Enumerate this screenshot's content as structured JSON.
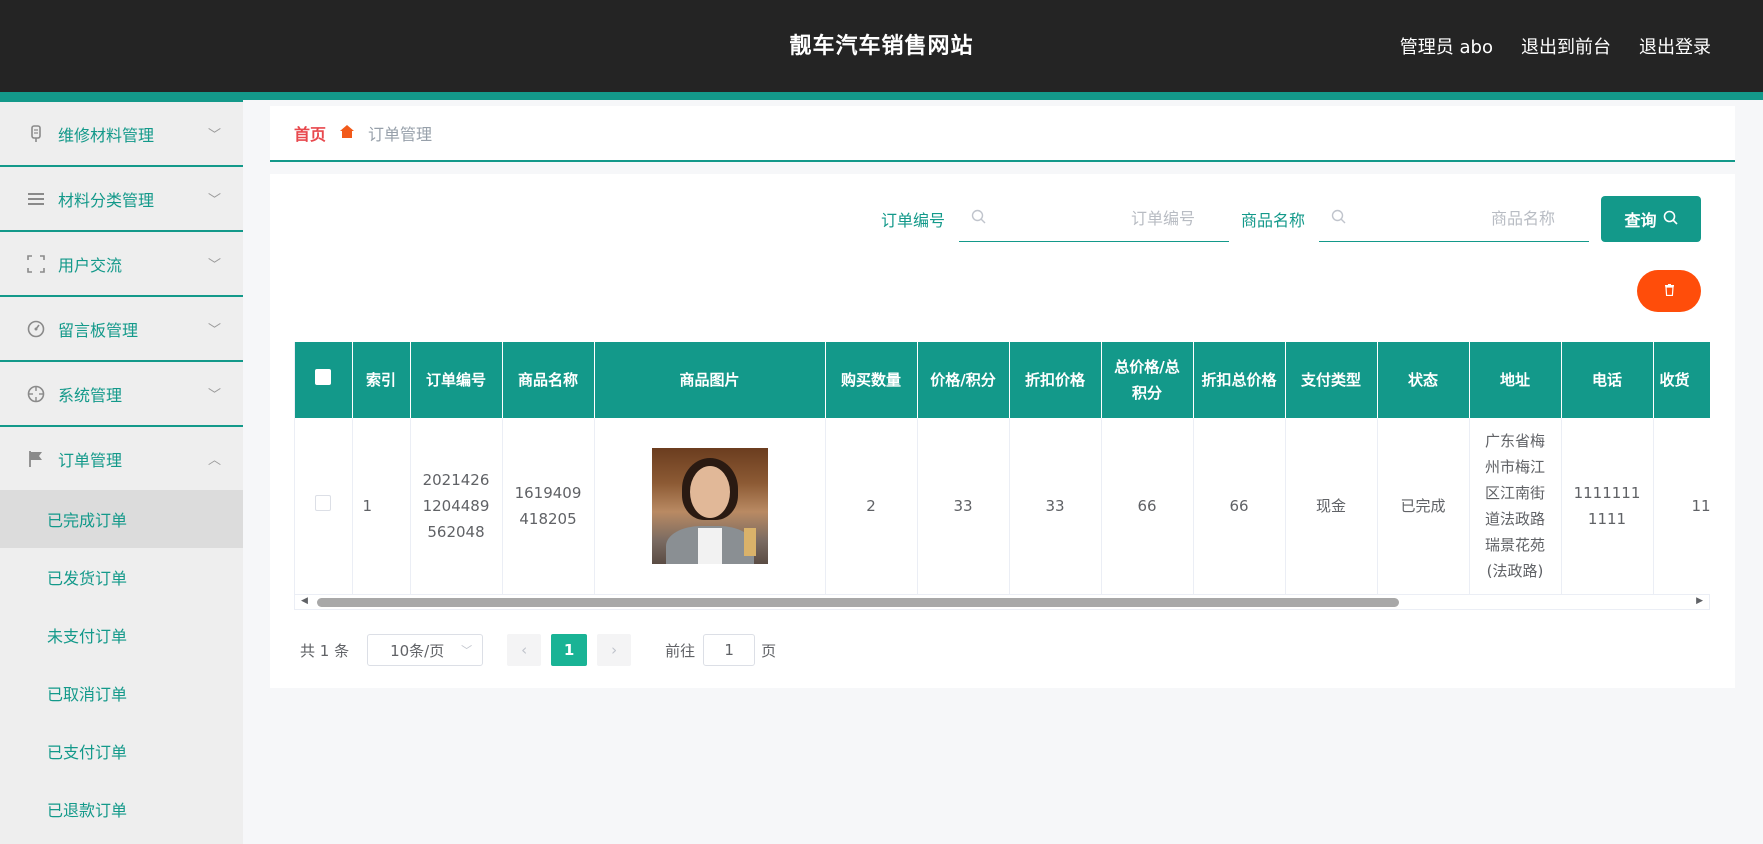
{
  "header": {
    "site_title": "靓车汽车销售网站",
    "admin_label": "管理员 abo",
    "back_to_front": "退出到前台",
    "logout": "退出登录"
  },
  "sidebar": {
    "menus": [
      {
        "label": "维修材料管理",
        "icon": "tool-icon",
        "expanded": false
      },
      {
        "label": "材料分类管理",
        "icon": "list-icon",
        "expanded": false
      },
      {
        "label": "用户交流",
        "icon": "frame-icon",
        "expanded": false
      },
      {
        "label": "留言板管理",
        "icon": "dashboard-icon",
        "expanded": false
      },
      {
        "label": "系统管理",
        "icon": "crosshair-icon",
        "expanded": false
      },
      {
        "label": "订单管理",
        "icon": "flag-icon",
        "expanded": true
      }
    ],
    "submenu": [
      "已完成订单",
      "已发货订单",
      "未支付订单",
      "已取消订单",
      "已支付订单",
      "已退款订单"
    ],
    "active_submenu": "已完成订单"
  },
  "breadcrumb": {
    "home": "首页",
    "current": "订单管理"
  },
  "search": {
    "order_no_label": "订单编号",
    "order_no_placeholder": "订单编号",
    "goods_name_label": "商品名称",
    "goods_name_placeholder": "商品名称",
    "query_button": "查询"
  },
  "table": {
    "columns": [
      "索引",
      "订单编号",
      "商品名称",
      "商品图片",
      "购买数量",
      "价格/积分",
      "折扣价格",
      "总价格/总积分",
      "折扣总价格",
      "支付类型",
      "状态",
      "地址",
      "电话",
      "收货"
    ],
    "rows": [
      {
        "index": "1",
        "order_no": "20214261204489562048",
        "goods_name": "1619409418205",
        "quantity": "2",
        "price": "33",
        "discount_price": "33",
        "total_price": "66",
        "discount_total": "66",
        "pay_type": "现金",
        "status": "已完成",
        "address": "广东省梅州市梅江区江南街道法政路瑞景花苑(法政路)",
        "phone": "11111111111",
        "receiver": "11"
      }
    ]
  },
  "pagination": {
    "total": "共 1 条",
    "page_size": "10条/页",
    "current_page": "1",
    "goto_label": "前往",
    "goto_value": "1",
    "page_unit": "页"
  },
  "colors": {
    "accent": "#13998a",
    "header_bg": "#242424",
    "delete": "#ff4d0a",
    "pager_active": "#19b395"
  }
}
